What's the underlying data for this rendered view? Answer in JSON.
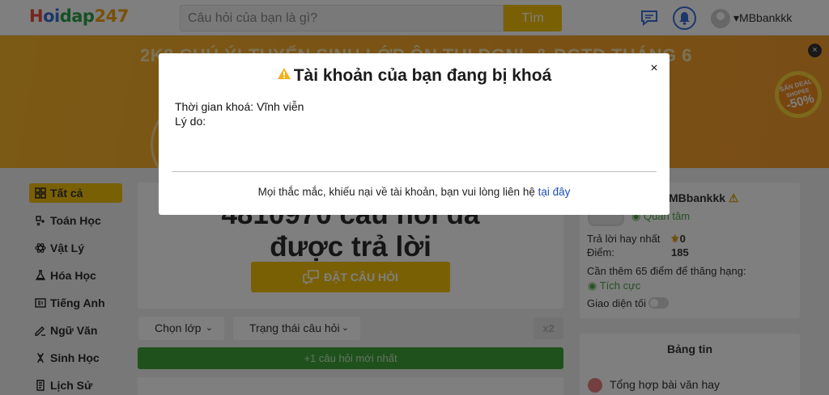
{
  "header": {
    "logo": {
      "part1": "H",
      "part2": "oi",
      "part3": "dap",
      "part4": "247"
    },
    "search": {
      "placeholder": "Câu hỏi của bạn là gì?",
      "button_label": "Tìm"
    },
    "username": "MBbankkk"
  },
  "banner": {
    "headline": "2K8 CHÚ Ý! TUYỂN SINH LỚP ÔN THI ĐGNL & ĐGTD THÁNG 6",
    "sale_badge": {
      "line1": "SĂN DEAL",
      "line2": "SHOPEE",
      "line3": "-50%"
    },
    "close_label": "×"
  },
  "sidebar": {
    "items": [
      {
        "label": "Tất cả",
        "icon": "grid-icon",
        "active": true
      },
      {
        "label": "Toán Học",
        "icon": "math-icon"
      },
      {
        "label": "Vật Lý",
        "icon": "atom-icon"
      },
      {
        "label": "Hóa Học",
        "icon": "flask-icon"
      },
      {
        "label": "Tiếng Anh",
        "icon": "english-icon"
      },
      {
        "label": "Ngữ Văn",
        "icon": "book-icon"
      },
      {
        "label": "Sinh Học",
        "icon": "dna-icon"
      },
      {
        "label": "Lịch Sử",
        "icon": "history-icon"
      }
    ]
  },
  "main": {
    "answered_count_line1": "4810970 câu hỏi đã",
    "answered_count_line2": "được trả lời",
    "ask_button": "ĐẶT CÂU HỎI",
    "filter_grade": "Chọn lớp",
    "filter_status": "Trạng thái câu hỏi",
    "multiplier_badge": "x2",
    "new_questions_bar": "+1 câu hỏi mới nhất"
  },
  "profile": {
    "name": "MBbankkk",
    "follow_label": "Quan tâm",
    "best_answers_label": "Trả lời hay nhất",
    "best_answers_value": "0",
    "points_label": "Điểm:",
    "points_value": "185",
    "rank_hint": "Cần thêm 65 điểm để thăng hạng:",
    "status": "Tích cực",
    "dark_mode_label": "Giao diện tối"
  },
  "news": {
    "title": "Bảng tin",
    "first_item": "Tổng hợp bài văn hay"
  },
  "modal": {
    "title": "Tài khoản của bạn đang bị khoá",
    "lock_time": "Thời gian khoá: Vĩnh viễn",
    "reason_label": "Lý do:",
    "footer_text": "Mọi thắc mắc, khiếu nại về tài khoản, bạn vui lòng liên hệ ",
    "footer_link": "tại đây",
    "close_label": "×"
  },
  "colors": {
    "accent": "#f5c00b",
    "green": "#3fa33a",
    "banner": "#f5a72a",
    "link": "#1e4fb5"
  }
}
